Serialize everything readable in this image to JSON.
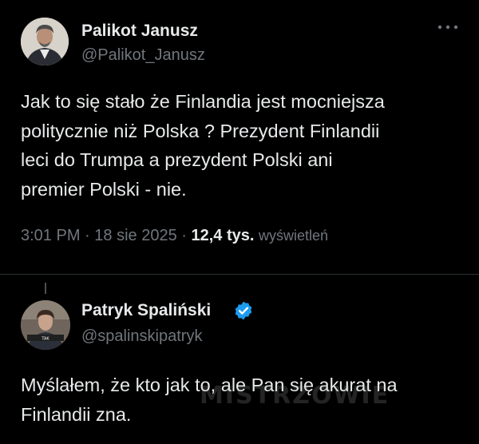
{
  "original_tweet": {
    "author": {
      "display_name": "Palikot Janusz",
      "handle": "@Palikot_Janusz"
    },
    "more_icon": "more-horizontal-icon",
    "text_lines": [
      "Jak to się stało że Finlandia jest mocniejsza",
      "politycznie niż Polska ? Prezydent Finlandii",
      "leci do Trumpa a prezydent Polski ani",
      "premier Polski - nie."
    ],
    "time": "3:01 PM",
    "separator": "·",
    "date": "18 sie 2025",
    "views_count": "12,4 tys.",
    "views_label": "wyświetleń"
  },
  "reply_tweet": {
    "author": {
      "display_name": "Patryk Spaliński",
      "handle": "@spalinskipatryk",
      "verified": true,
      "verified_icon": "verified-badge-icon"
    },
    "text_lines": [
      "Myślałem, że kto jak to, ale Pan się akurat na",
      "Finlandii zna."
    ]
  },
  "watermark": "MISTRZOWIE",
  "colors": {
    "background": "#000000",
    "text_primary": "#e7e9ea",
    "text_secondary": "#71767b",
    "divider": "#2f3336",
    "verified": "#1d9bf0"
  }
}
